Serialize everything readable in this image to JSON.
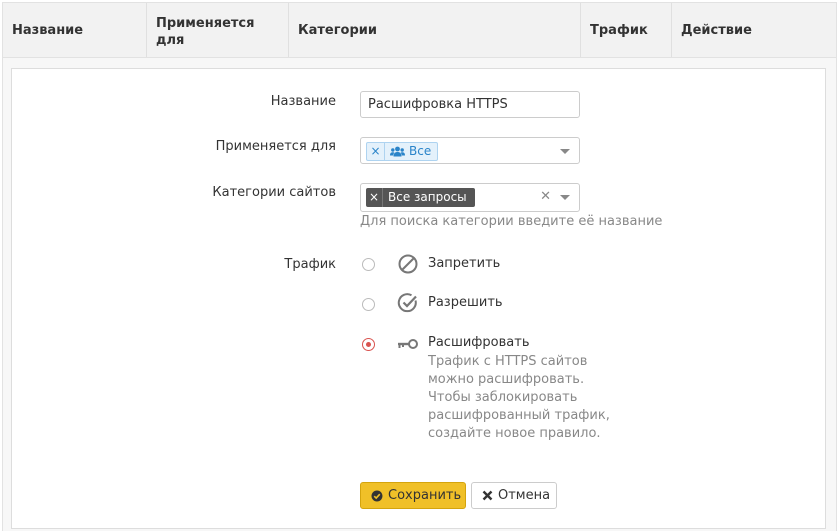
{
  "table": {
    "columns": [
      {
        "line1": "Название",
        "line2": ""
      },
      {
        "line1": "Применяется",
        "line2": "для"
      },
      {
        "line1": "Категории",
        "line2": ""
      },
      {
        "line1": "Трафик",
        "line2": ""
      },
      {
        "line1": "Действие",
        "line2": ""
      }
    ]
  },
  "form": {
    "name_label": "Название",
    "name_value": "Расшифровка HTTPS",
    "applies_label": "Применяется для",
    "applies_tag": "Все",
    "categories_label": "Категории сайтов",
    "categories_tag": "Все запросы",
    "categories_hint": "Для поиска категории введите её название",
    "traffic_label": "Трафик",
    "options": [
      {
        "label": "Запретить",
        "icon": "ban-icon",
        "selected": false
      },
      {
        "label": "Разрешить",
        "icon": "check-circle-icon",
        "selected": false
      },
      {
        "label": "Расшифровать",
        "icon": "key-icon",
        "selected": true
      }
    ],
    "decrypt_description": "Трафик с HTTPS сайтов можно расшифровать. Чтобы заблокировать расшифрованный трафик, создайте новое правило.",
    "save_label": "Сохранить",
    "cancel_label": "Отмена"
  },
  "colors": {
    "save_button": "#f0c028",
    "radio_selected": "#d9534f",
    "tag_blue": "#2a84c9",
    "tag_dark": "#555555"
  }
}
